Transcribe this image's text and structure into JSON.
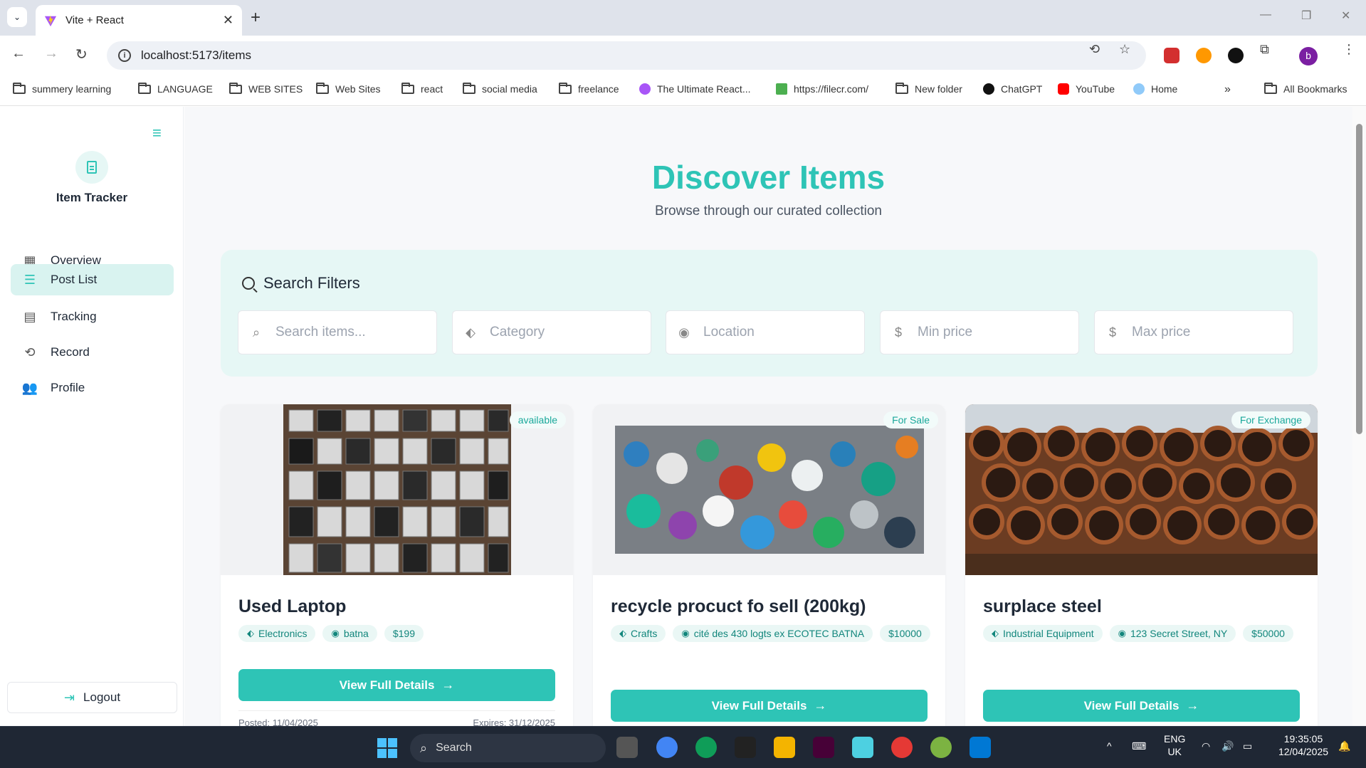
{
  "browser": {
    "tab_title": "Vite + React",
    "url": "localhost:5173/items",
    "avatar_letter": "b",
    "bookmarks": [
      {
        "label": "summery learning",
        "type": "folder"
      },
      {
        "label": "LANGUAGE",
        "type": "folder"
      },
      {
        "label": "WEB SITES",
        "type": "folder"
      },
      {
        "label": "Web Sites",
        "type": "folder"
      },
      {
        "label": "react",
        "type": "folder"
      },
      {
        "label": "social media",
        "type": "folder"
      },
      {
        "label": "freelance",
        "type": "folder"
      },
      {
        "label": "The Ultimate React...",
        "type": "site"
      },
      {
        "label": "https://filecr.com/",
        "type": "site"
      },
      {
        "label": "New folder",
        "type": "folder"
      },
      {
        "label": "ChatGPT",
        "type": "site"
      },
      {
        "label": "YouTube",
        "type": "site"
      },
      {
        "label": "Home",
        "type": "site"
      }
    ],
    "all_bookmarks": "All Bookmarks"
  },
  "sidebar": {
    "brand": "Item Tracker",
    "items": [
      {
        "label": "Overview",
        "icon": "dashboard-icon"
      },
      {
        "label": "Post List",
        "icon": "list-icon",
        "active": true
      },
      {
        "label": "Tracking",
        "icon": "chat-icon"
      },
      {
        "label": "Record",
        "icon": "history-icon"
      },
      {
        "label": "Profile",
        "icon": "people-icon"
      }
    ],
    "logout": "Logout"
  },
  "page": {
    "title": "Discover Items",
    "subtitle": "Browse through our curated collection"
  },
  "filters": {
    "heading": "Search Filters",
    "search_placeholder": "Search items...",
    "category_placeholder": "Category",
    "location_placeholder": "Location",
    "min_price_placeholder": "Min price",
    "max_price_placeholder": "Max price"
  },
  "cards": [
    {
      "badge": "available",
      "title": "Used Laptop",
      "category": "Electronics",
      "location": "batna",
      "price": "$199",
      "button": "View Full Details",
      "posted": "Posted: 11/04/2025",
      "expires": "Expires: 31/12/2025"
    },
    {
      "badge": "For Sale",
      "title": "recycle procuct fo sell (200kg)",
      "category": "Crafts",
      "location": "cité des 430 logts ex ECOTEC BATNA",
      "price": "$10000",
      "button": "View Full Details"
    },
    {
      "badge": "For Exchange",
      "title": "surplace steel",
      "category": "Industrial Equipment",
      "location": "123 Secret Street, NY",
      "price": "$50000",
      "button": "View Full Details"
    }
  ],
  "taskbar": {
    "search": "Search",
    "lang": "ENG",
    "region": "UK",
    "time": "19:35:05",
    "date": "12/04/2025"
  },
  "colors": {
    "accent": "#2ec4b6",
    "filter_bg": "#e6f7f5"
  }
}
